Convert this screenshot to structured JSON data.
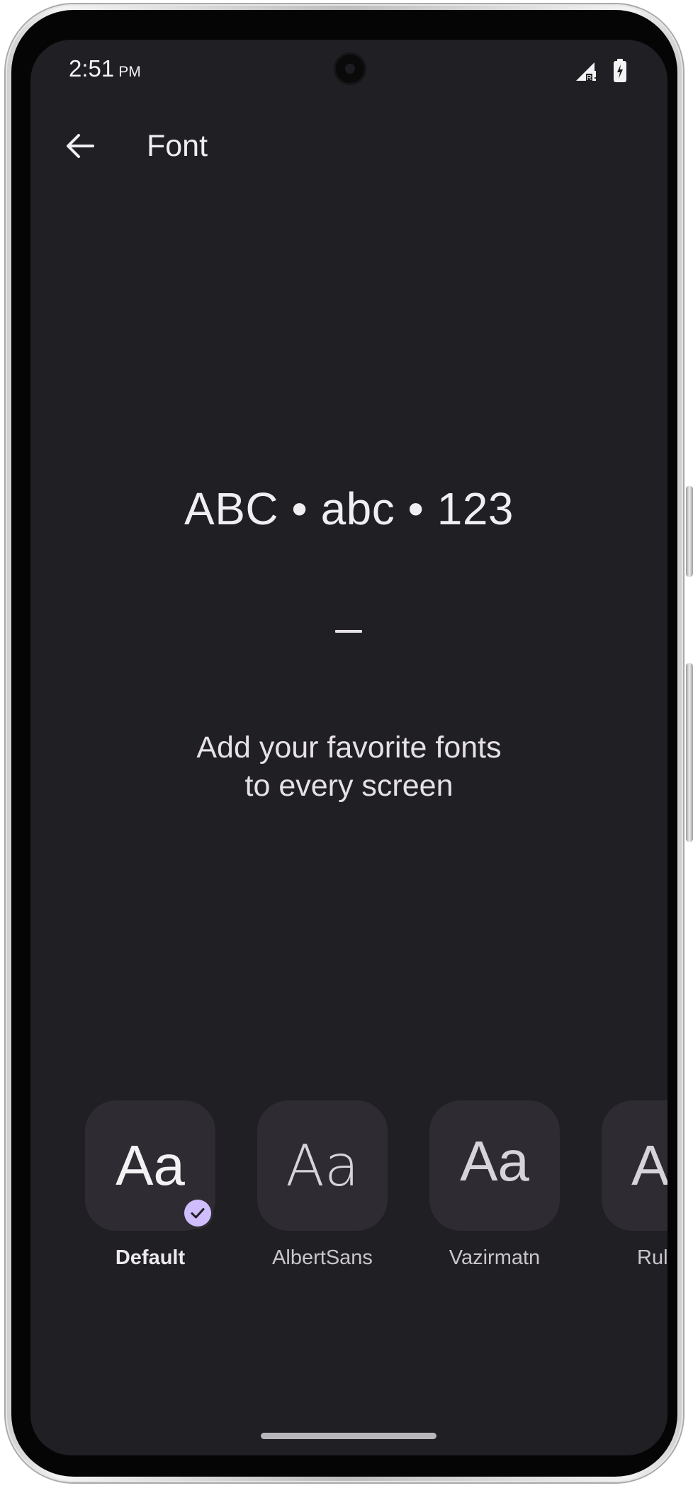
{
  "status_bar": {
    "time": "2:51",
    "ampm": "PM",
    "icons": [
      "cell-signal-icon",
      "battery-charging-icon"
    ]
  },
  "app_bar": {
    "back_icon": "arrow-back-icon",
    "title": "Font"
  },
  "preview": {
    "sample_text": "ABC • abc • 123",
    "separator": "–",
    "tagline_line1": "Add your favorite fonts",
    "tagline_line2": "to every screen"
  },
  "fonts": [
    {
      "sample": "Aa",
      "label": "Default",
      "selected": true
    },
    {
      "sample": "Aa",
      "label": "AlbertSans",
      "selected": false
    },
    {
      "sample": "Aa",
      "label": "Vazirmatn",
      "selected": false
    },
    {
      "sample": "A",
      "label": "Rul",
      "selected": false
    }
  ],
  "colors": {
    "background": "#201f24",
    "tile": "#2e2c32",
    "accent": "#cfbdfe",
    "text": "#e6e1e6"
  }
}
